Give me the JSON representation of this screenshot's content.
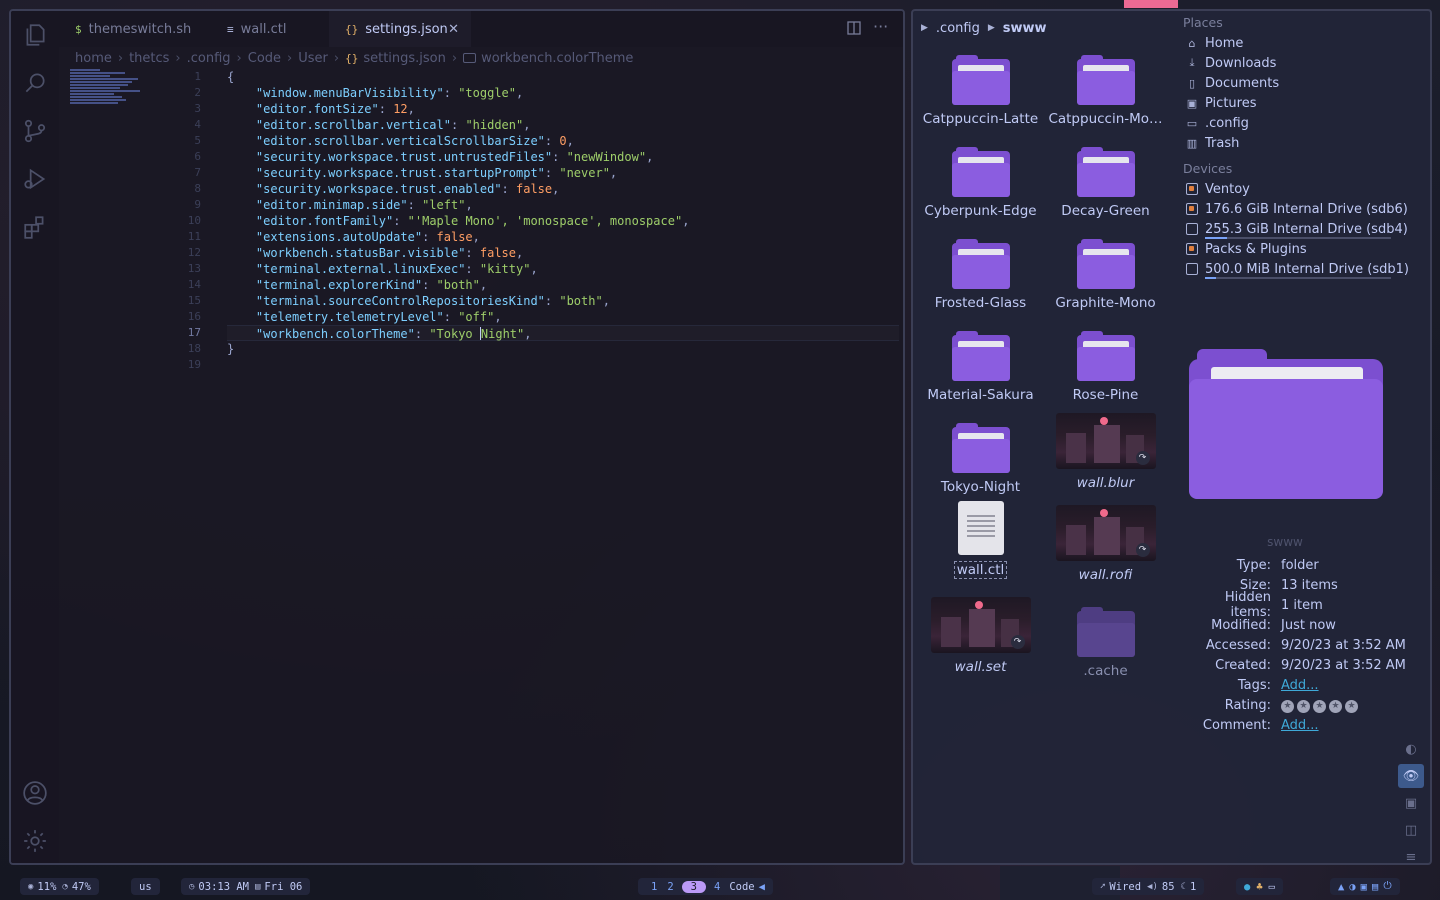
{
  "vscode": {
    "tabs": [
      {
        "label": "themeswitch.sh",
        "icon": "$"
      },
      {
        "label": "wall.ctl",
        "icon": "≡"
      },
      {
        "label": "settings.json",
        "icon": "{}"
      }
    ],
    "close_glyph": "✕",
    "breadcrumb": [
      "home",
      "thetcs",
      ".config",
      "Code",
      "User",
      "settings.json",
      "workbench.colorTheme"
    ],
    "breadcrumb_json_glyph": "{}",
    "line_numbers": [
      "1",
      "2",
      "3",
      "4",
      "5",
      "6",
      "7",
      "8",
      "9",
      "10",
      "11",
      "12",
      "13",
      "14",
      "15",
      "16",
      "17",
      "18",
      "19"
    ],
    "current_line": "17",
    "code": {
      "l1": "{",
      "l18": "}",
      "settings": [
        {
          "key": "\"window.menuBarVisibility\"",
          "value": "\"toggle\"",
          "type": "str"
        },
        {
          "key": "\"editor.fontSize\"",
          "value": "12",
          "type": "num"
        },
        {
          "key": "\"editor.scrollbar.vertical\"",
          "value": "\"hidden\"",
          "type": "str"
        },
        {
          "key": "\"editor.scrollbar.verticalScrollbarSize\"",
          "value": "0",
          "type": "num"
        },
        {
          "key": "\"security.workspace.trust.untrustedFiles\"",
          "value": "\"newWindow\"",
          "type": "str"
        },
        {
          "key": "\"security.workspace.trust.startupPrompt\"",
          "value": "\"never\"",
          "type": "str"
        },
        {
          "key": "\"security.workspace.trust.enabled\"",
          "value": "false",
          "type": "bool"
        },
        {
          "key": "\"editor.minimap.side\"",
          "value": "\"left\"",
          "type": "str"
        },
        {
          "key": "\"editor.fontFamily\"",
          "value": "\"'Maple Mono', 'monospace', monospace\"",
          "type": "str"
        },
        {
          "key": "\"extensions.autoUpdate\"",
          "value": "false",
          "type": "bool"
        },
        {
          "key": "\"workbench.statusBar.visible\"",
          "value": "false",
          "type": "bool"
        },
        {
          "key": "\"terminal.external.linuxExec\"",
          "value": "\"kitty\"",
          "type": "str"
        },
        {
          "key": "\"terminal.explorerKind\"",
          "value": "\"both\"",
          "type": "str"
        },
        {
          "key": "\"terminal.sourceControlRepositoriesKind\"",
          "value": "\"both\"",
          "type": "str"
        },
        {
          "key": "\"telemetry.telemetryLevel\"",
          "value": "\"off\"",
          "type": "str"
        }
      ],
      "l17_key": "\"workbench.colorTheme\"",
      "l17_value_before": "\"Tokyo ",
      "l17_value_after": "Night\""
    }
  },
  "filemanager": {
    "path": [
      ".config",
      "swww"
    ],
    "items": [
      {
        "name": "Catppuccin-Latte",
        "kind": "folder"
      },
      {
        "name": "Catppuccin-Mo…",
        "kind": "folder"
      },
      {
        "name": "Cyberpunk-Edge",
        "kind": "folder"
      },
      {
        "name": "Decay-Green",
        "kind": "folder"
      },
      {
        "name": "Frosted-Glass",
        "kind": "folder"
      },
      {
        "name": "Graphite-Mono",
        "kind": "folder"
      },
      {
        "name": "Material-Sakura",
        "kind": "folder"
      },
      {
        "name": "Rose-Pine",
        "kind": "folder"
      },
      {
        "name": "Tokyo-Night",
        "kind": "folder"
      },
      {
        "name": "wall.blur",
        "kind": "image-link"
      },
      {
        "name": "wall.ctl",
        "kind": "text"
      },
      {
        "name": "wall.rofi",
        "kind": "image-link"
      },
      {
        "name": "wall.set",
        "kind": "image-link"
      },
      {
        "name": ".cache",
        "kind": "hidden-folder"
      }
    ],
    "places_header": "Places",
    "places": [
      {
        "label": "Home",
        "icon": "home-icon"
      },
      {
        "label": "Downloads",
        "icon": "download-icon"
      },
      {
        "label": "Documents",
        "icon": "document-icon"
      },
      {
        "label": "Pictures",
        "icon": "image-icon"
      },
      {
        "label": ".config",
        "icon": "folder-icon"
      },
      {
        "label": "Trash",
        "icon": "trash-icon"
      }
    ],
    "devices_header": "Devices",
    "devices": [
      {
        "label": "Ventoy",
        "usage": null
      },
      {
        "label": "176.6 GiB Internal Drive (sdb6)",
        "usage": null
      },
      {
        "label": "255.3 GiB Internal Drive (sdb4)",
        "usage": 0.12
      },
      {
        "label": "Packs & Plugins",
        "usage": null
      },
      {
        "label": "500.0 MiB Internal Drive (sdb1)",
        "usage": 0.06
      }
    ],
    "info": {
      "title": "swww",
      "rows": [
        {
          "k": "Type:",
          "v": "folder"
        },
        {
          "k": "Size:",
          "v": "13 items"
        },
        {
          "k": "Hidden items:",
          "v": "1 item"
        },
        {
          "k": "Modified:",
          "v": "Just now"
        },
        {
          "k": "Accessed:",
          "v": "9/20/23 at 3:52 AM"
        },
        {
          "k": "Created:",
          "v": "9/20/23 at 3:52 AM"
        }
      ],
      "tags_label": "Tags:",
      "tags_value": "Add...",
      "rating_label": "Rating:",
      "rating": 0,
      "comment_label": "Comment:",
      "comment_value": "Add..."
    }
  },
  "statusbar": {
    "cpu": "11%",
    "mem": "47%",
    "keyboard": "us",
    "time": "03:13 AM",
    "date": "Fri 06",
    "workspaces": [
      "1",
      "2",
      "3",
      "4"
    ],
    "active_workspace": "3",
    "active_app": "Code",
    "network": "Wired",
    "volume": "85",
    "brightness": "1"
  },
  "colors": {
    "accent": "#bb9af7",
    "folder": "#8b5de0",
    "link": "#3fa9d8",
    "string": "#9ece6a",
    "number": "#ff9e64",
    "key": "#7dcfff"
  }
}
